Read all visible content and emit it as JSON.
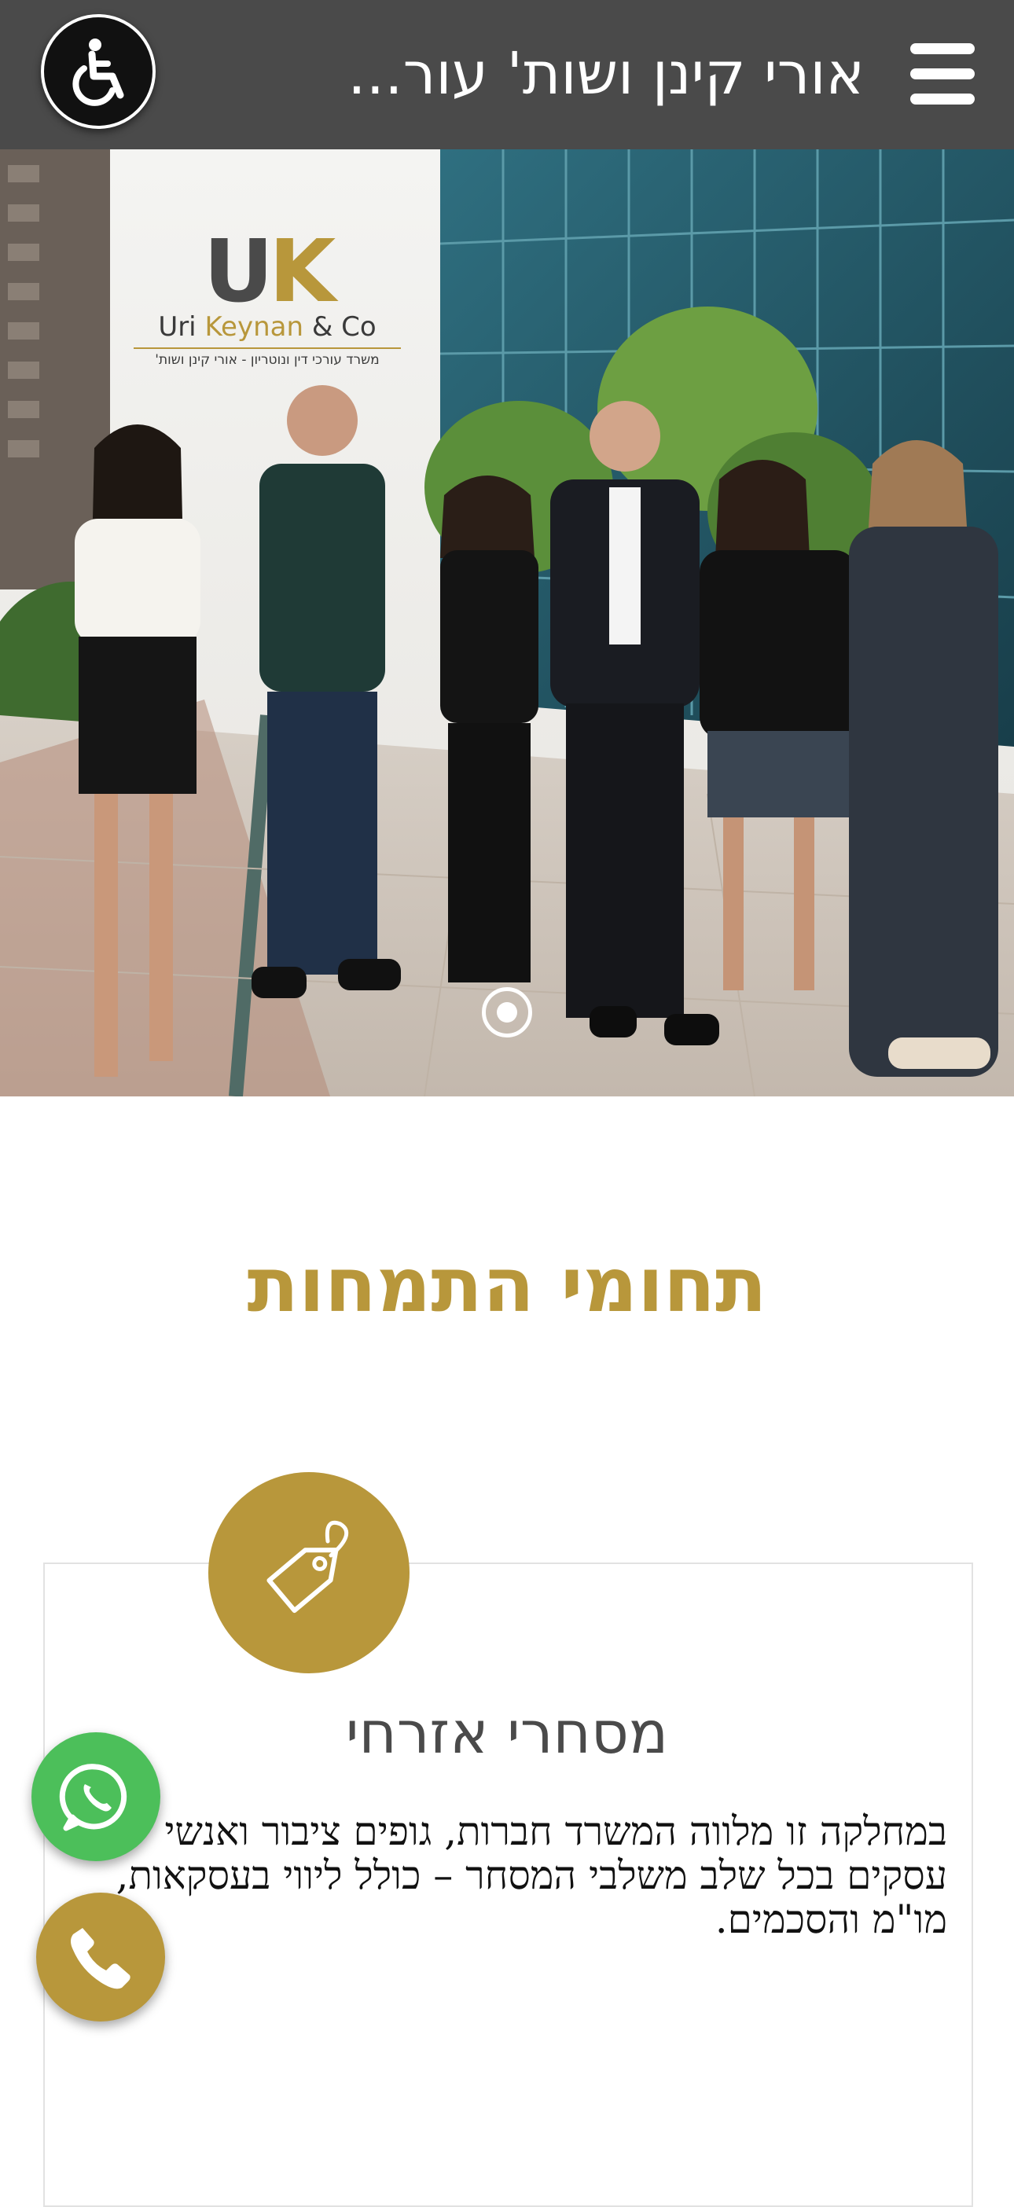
{
  "header": {
    "site_title": "אורי קינן ושות' עור...",
    "menu_icon": "hamburger-menu-icon",
    "accessibility_icon": "wheelchair-accessibility-icon"
  },
  "hero": {
    "logo": {
      "mark_u": "U",
      "mark_k": "K",
      "name_start": "Uri ",
      "name_keynan": "Keynan",
      "name_end": " & Co",
      "tagline": "משרד עורכי דין ונוטריון - אורי קינן ושות'"
    },
    "slider_indicator_icon": "slider-dot-icon"
  },
  "section": {
    "title": "תחומי התמחות",
    "card": {
      "icon": "price-tag-icon",
      "title": "מסחרי אזרחי",
      "text": "במחלקה זו מלווה המשרד חברות, גופים ציבור ואנשי עסקים בכל שלב משלבי המסחר – כולל ליווי בעסקאות, מו\"מ והסכמים."
    }
  },
  "floating": {
    "whatsapp_icon": "whatsapp-icon",
    "phone_icon": "phone-icon"
  },
  "colors": {
    "header_bg": "#4a4a4a",
    "accent_gold": "#b8973b",
    "whatsapp_green": "#4cbf5a"
  }
}
